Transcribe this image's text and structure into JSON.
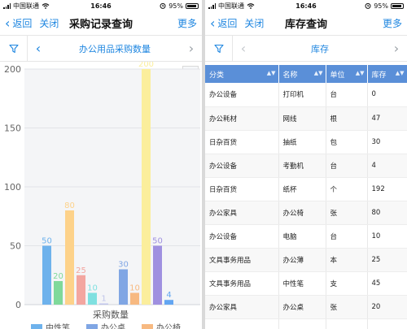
{
  "status": {
    "carrier": "中国联通",
    "time": "16:46",
    "battery": "95%"
  },
  "left": {
    "nav": {
      "back": "返回",
      "close": "关闭",
      "title": "采购记录查询",
      "more": "更多"
    },
    "subtitle": "办公用品采购数量",
    "chart_data": {
      "type": "bar",
      "xlabel": "采购数量",
      "ylim": [
        0,
        200
      ],
      "yticks": [
        0,
        50,
        100,
        150,
        200
      ],
      "groups": [
        {
          "bars": [
            {
              "value": 50,
              "color": "#6eb2ec"
            },
            {
              "value": 20,
              "color": "#7fd99a"
            },
            {
              "value": 80,
              "color": "#fdd28a"
            },
            {
              "value": 25,
              "color": "#f3a6a0"
            },
            {
              "value": 10,
              "color": "#7fe0e0"
            },
            {
              "value": 1,
              "color": "#bfc4ea"
            }
          ]
        },
        {
          "bars": [
            {
              "value": 30,
              "color": "#80a6e4"
            },
            {
              "value": 10,
              "color": "#f7b981"
            },
            {
              "value": 200,
              "color": "#fbee9c"
            },
            {
              "value": 50,
              "color": "#9f90e0"
            },
            {
              "value": 4,
              "color": "#63a6f2"
            }
          ]
        }
      ],
      "legend": [
        {
          "label": "中性笔",
          "color": "#6eb2ec"
        },
        {
          "label": "办公桌",
          "color": "#80a6e4"
        },
        {
          "label": "办公椅",
          "color": "#f7b981"
        }
      ],
      "grid": true
    }
  },
  "right": {
    "nav": {
      "back": "返回",
      "close": "关闭",
      "title": "库存查询",
      "more": "更多"
    },
    "subtitle": "库存",
    "table": {
      "headers": [
        "分类",
        "名称",
        "单位",
        "库存"
      ],
      "rows": [
        [
          "办公设备",
          "打印机",
          "台",
          "0"
        ],
        [
          "办公耗材",
          "网线",
          "根",
          "47"
        ],
        [
          "日杂百货",
          "抽纸",
          "包",
          "30"
        ],
        [
          "办公设备",
          "考勤机",
          "台",
          "4"
        ],
        [
          "日杂百货",
          "纸杯",
          "个",
          "192"
        ],
        [
          "办公家具",
          "办公椅",
          "张",
          "80"
        ],
        [
          "办公设备",
          "电脑",
          "台",
          "10"
        ],
        [
          "文具事务用品",
          "办公薄",
          "本",
          "25"
        ],
        [
          "文具事务用品",
          "中性笔",
          "支",
          "45"
        ],
        [
          "办公家具",
          "办公桌",
          "张",
          "20"
        ],
        [
          "",
          "",
          "",
          ""
        ]
      ]
    }
  }
}
